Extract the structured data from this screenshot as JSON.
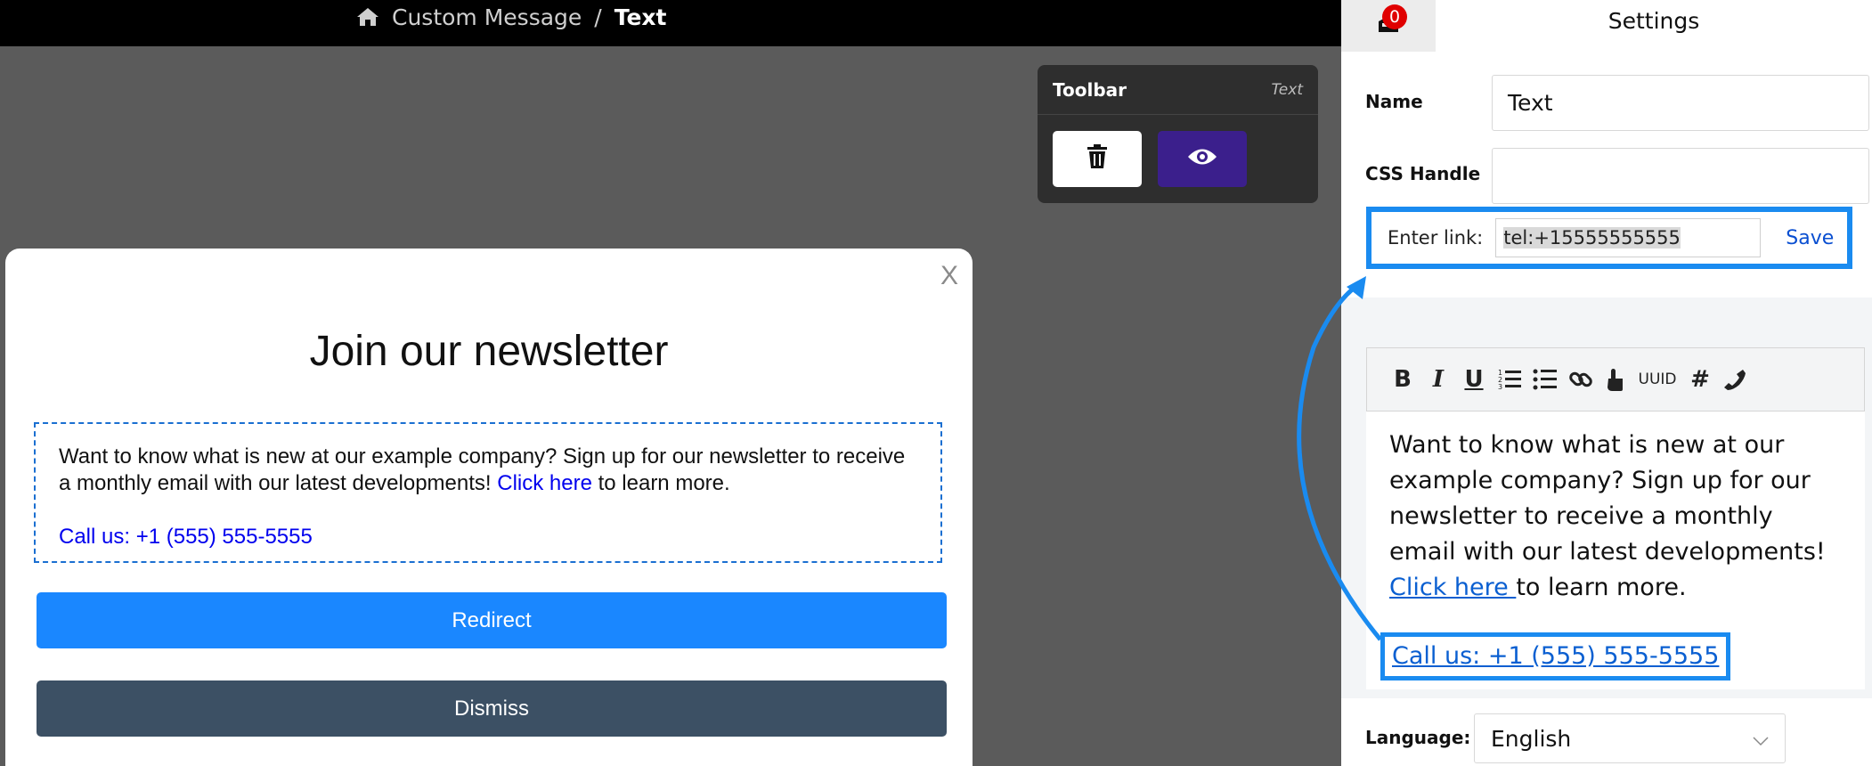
{
  "breadcrumb": {
    "parent": "Custom Message",
    "separator": "/",
    "current": "Text",
    "home_icon": "home-icon"
  },
  "toolbar": {
    "title": "Toolbar",
    "type": "Text",
    "delete_icon": "trash-icon",
    "preview_icon": "eye-icon"
  },
  "modal": {
    "close": "X",
    "title": "Join our newsletter",
    "text_before": "Want to know what is new at our example company? Sign up for our newsletter to receive a monthly email with our latest developments! ",
    "link_text": "Click here",
    "text_after": " to learn more.",
    "call_text": "Call us: +1 (555) 555-5555",
    "redirect_label": "Redirect",
    "dismiss_label": "Dismiss"
  },
  "settings": {
    "badge_count": "0",
    "title": "Settings",
    "name_label": "Name",
    "name_value": "Text",
    "css_label": "CSS Handle",
    "css_value": "",
    "link_label": "Enter link:",
    "link_value": "tel:+15555555555",
    "save_label": "Save",
    "editor_tools": [
      "B",
      "I",
      "U",
      "ordered-list",
      "bullet-list",
      "link",
      "hand-pointer",
      "UUID",
      "#",
      "phone"
    ],
    "uuid_label": "UUID",
    "editor_text_before": "Want to know what is new at our example company? Sign up for our newsletter to receive a monthly email with our latest developments! ",
    "editor_link_text": "Click here ",
    "editor_text_after": "to learn more.",
    "editor_call_text": "Call us: +1 (555) 555-5555",
    "language_label": "Language:",
    "language_value": "English"
  },
  "colors": {
    "primary": "#1a87ff",
    "dismiss": "#3c5064",
    "preview": "#3b1f8c",
    "highlight": "#1a8bf0",
    "link": "#0000ee"
  }
}
